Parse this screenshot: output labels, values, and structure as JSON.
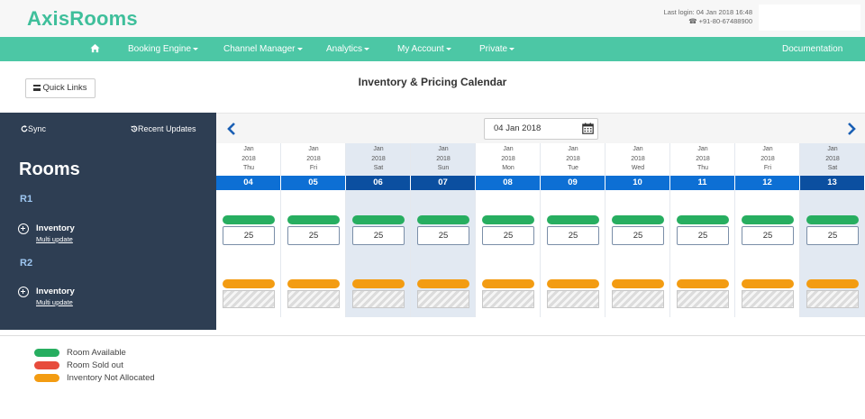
{
  "header": {
    "logo": "AxisRooms",
    "last_login": "Last login: 04 Jan 2018 16:48",
    "phone": "+91-80-67488900"
  },
  "nav": {
    "items": [
      {
        "label": "Booking Engine",
        "dropdown": true
      },
      {
        "label": "Channel Manager",
        "dropdown": true
      },
      {
        "label": "Analytics",
        "dropdown": true
      },
      {
        "label": "My Account",
        "dropdown": true
      },
      {
        "label": "Private",
        "dropdown": true
      },
      {
        "label": "Documentation",
        "dropdown": false
      }
    ]
  },
  "toolbar": {
    "quick_links": "Quick Links",
    "title": "Inventory & Pricing Calendar"
  },
  "panel": {
    "sync": "Sync",
    "recent_updates": "Recent Updates",
    "rooms_title": "Rooms",
    "rooms": [
      {
        "code": "R1",
        "inventory_label": "Inventory",
        "multi_update": "Multi update"
      },
      {
        "code": "R2",
        "inventory_label": "Inventory",
        "multi_update": "Multi update"
      }
    ]
  },
  "datepicker": {
    "value": "04 Jan 2018"
  },
  "calendar": {
    "days": [
      {
        "month": "Jan",
        "year": "2018",
        "weekday": "Thu",
        "day": "04",
        "weekend": false,
        "r1_inventory": "25"
      },
      {
        "month": "Jan",
        "year": "2018",
        "weekday": "Fri",
        "day": "05",
        "weekend": false,
        "r1_inventory": "25"
      },
      {
        "month": "Jan",
        "year": "2018",
        "weekday": "Sat",
        "day": "06",
        "weekend": true,
        "r1_inventory": "25"
      },
      {
        "month": "Jan",
        "year": "2018",
        "weekday": "Sun",
        "day": "07",
        "weekend": true,
        "r1_inventory": "25"
      },
      {
        "month": "Jan",
        "year": "2018",
        "weekday": "Mon",
        "day": "08",
        "weekend": false,
        "r1_inventory": "25"
      },
      {
        "month": "Jan",
        "year": "2018",
        "weekday": "Tue",
        "day": "09",
        "weekend": false,
        "r1_inventory": "25"
      },
      {
        "month": "Jan",
        "year": "2018",
        "weekday": "Wed",
        "day": "10",
        "weekend": false,
        "r1_inventory": "25"
      },
      {
        "month": "Jan",
        "year": "2018",
        "weekday": "Thu",
        "day": "11",
        "weekend": false,
        "r1_inventory": "25"
      },
      {
        "month": "Jan",
        "year": "2018",
        "weekday": "Fri",
        "day": "12",
        "weekend": false,
        "r1_inventory": "25"
      },
      {
        "month": "Jan",
        "year": "2018",
        "weekday": "Sat",
        "day": "13",
        "weekend": true,
        "r1_inventory": "25"
      }
    ]
  },
  "legend": [
    {
      "label": "Room Available",
      "color": "#27ae60"
    },
    {
      "label": "Room Sold out",
      "color": "#e74c3c"
    },
    {
      "label": "Inventory Not Allocated",
      "color": "#f39c12"
    }
  ],
  "colors": {
    "brand": "#3fbf9b",
    "nav": "#4cc7a5",
    "panel": "#2e3e53",
    "date_blue": "#0d6fd4",
    "weekend_blue": "#0b4fa0"
  }
}
